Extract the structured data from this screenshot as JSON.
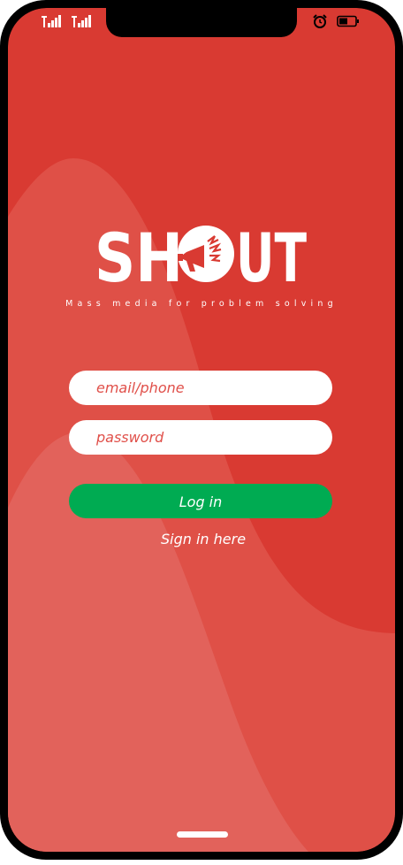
{
  "status_bar": {
    "left_icons": [
      "signal-icon",
      "signal-icon"
    ],
    "right_icons": [
      "alarm-clock-icon",
      "battery-icon"
    ]
  },
  "brand": {
    "logo_text": "SHOUT",
    "tagline": "Mass media for problem solving"
  },
  "login_form": {
    "email_placeholder": "email/phone",
    "email_value": "",
    "password_placeholder": "password",
    "password_value": "",
    "login_label": "Log in",
    "signin_label": "Sign in here"
  },
  "colors": {
    "background": "#d93a32",
    "wave_mid": "#df5047",
    "wave_light": "#e2625b",
    "button_green": "#00ab52",
    "placeholder_red": "#e0504a"
  }
}
